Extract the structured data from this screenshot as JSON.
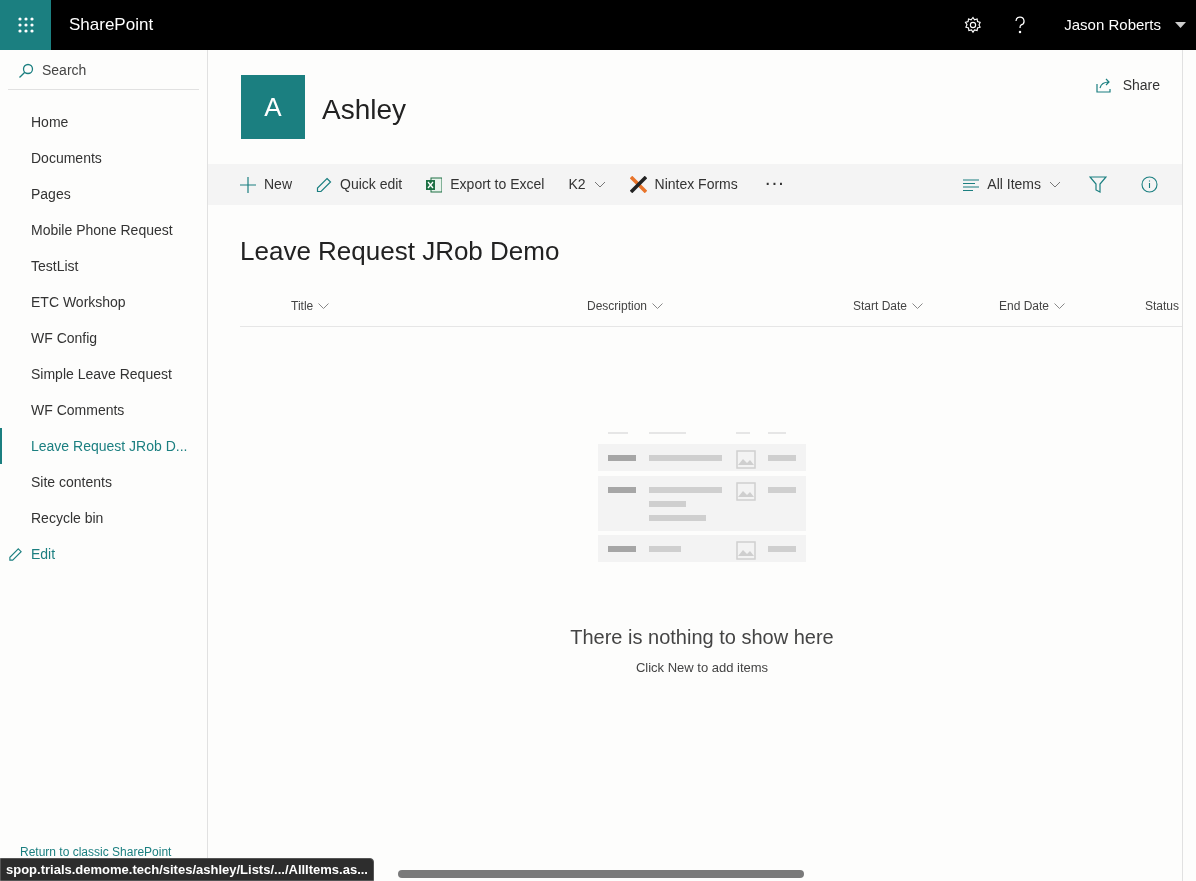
{
  "top_bar": {
    "app_name": "SharePoint",
    "user": "Jason Roberts"
  },
  "sidebar": {
    "search": {
      "placeholder": "Search"
    },
    "items": [
      {
        "label": "Home",
        "selected": false
      },
      {
        "label": "Documents",
        "selected": false
      },
      {
        "label": "Pages",
        "selected": false
      },
      {
        "label": "Mobile Phone Request",
        "selected": false
      },
      {
        "label": "TestList",
        "selected": false
      },
      {
        "label": "ETC Workshop",
        "selected": false
      },
      {
        "label": "WF Config",
        "selected": false
      },
      {
        "label": "Simple Leave Request",
        "selected": false
      },
      {
        "label": "WF Comments",
        "selected": false
      },
      {
        "label": "Leave Request JRob D...",
        "selected": true
      },
      {
        "label": "Site contents",
        "selected": false
      },
      {
        "label": "Recycle bin",
        "selected": false
      }
    ],
    "edit": "Edit",
    "classic_link": "Return to classic SharePoint"
  },
  "site": {
    "logo_letter": "A",
    "name": "Ashley",
    "share": "Share"
  },
  "command_bar": {
    "commands": [
      {
        "kind": "new",
        "label": "New"
      },
      {
        "kind": "edit",
        "label": "Quick edit"
      },
      {
        "kind": "excel",
        "label": "Export to Excel"
      },
      {
        "kind": "dropdown",
        "label": "K2"
      },
      {
        "kind": "nintex",
        "label": "Nintex Forms"
      },
      {
        "kind": "more",
        "label": "···"
      }
    ],
    "view": "All Items"
  },
  "list": {
    "title": "Leave Request JRob Demo",
    "columns": [
      "Title",
      "Description",
      "Start Date",
      "End Date",
      "Status"
    ],
    "empty_title": "There is nothing to show here",
    "empty_hint": "Click New to add items"
  },
  "status_url": "spop.trials.demome.tech/sites/ashley/Lists/.../AllItems.as..."
}
